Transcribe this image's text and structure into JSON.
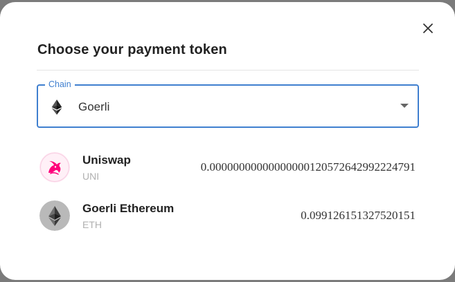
{
  "dialog": {
    "title": "Choose your payment token",
    "close_icon": "close-icon"
  },
  "chain": {
    "label": "Chain",
    "value": "Goerli",
    "icon": "ethereum-icon",
    "accent_color": "#3f7fcf"
  },
  "tokens": [
    {
      "name": "Uniswap",
      "symbol": "UNI",
      "balance": "0.0000000000000000012057264299222479\u00001",
      "icon": "uniswap-icon",
      "color": "#ff007a"
    },
    {
      "name": "Goerli Ethereum",
      "symbol": "ETH",
      "balance": "0.099126151327520151",
      "icon": "ethereum-icon",
      "color": "#b9b9b9"
    }
  ]
}
